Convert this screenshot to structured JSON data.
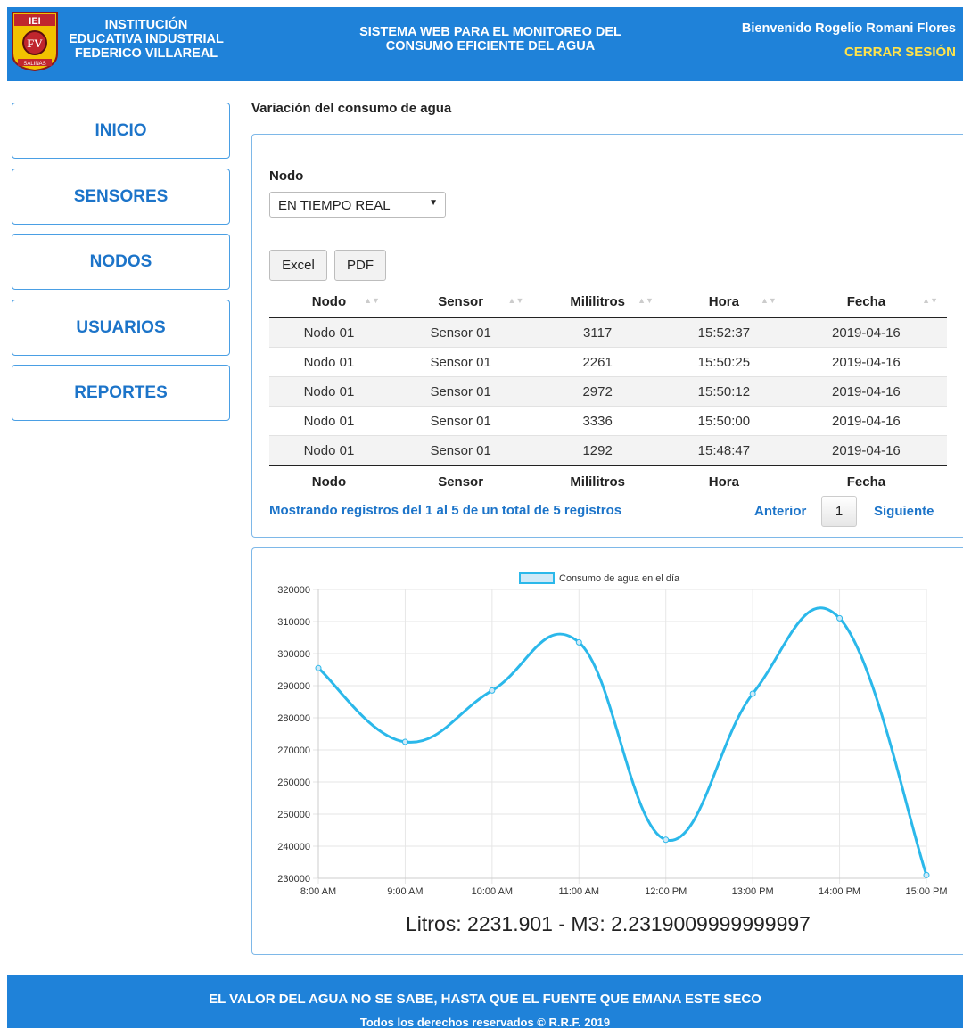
{
  "header": {
    "logo_text": "IEI",
    "logo_badge": "FV",
    "logo_caption": "SALINAS",
    "school_lines": [
      "INSTITUCIÓN",
      "EDUCATIVA INDUSTRIAL",
      "FEDERICO VILLAREAL"
    ],
    "system_lines": [
      "SISTEMA WEB PARA EL MONITOREO DEL",
      "CONSUMO EFICIENTE DEL AGUA"
    ],
    "welcome": "Bienvenido Rogelio Romani Flores",
    "logout": "CERRAR SESIÓN"
  },
  "sidebar": {
    "items": [
      {
        "label": "INICIO"
      },
      {
        "label": "SENSORES"
      },
      {
        "label": "NODOS"
      },
      {
        "label": "USUARIOS"
      },
      {
        "label": "REPORTES"
      }
    ]
  },
  "main": {
    "title": "Variación del consumo de agua",
    "nodo_label": "Nodo",
    "nodo_selected": "EN TIEMPO REAL",
    "buttons": {
      "excel": "Excel",
      "pdf": "PDF"
    },
    "table": {
      "columns": [
        "Nodo",
        "Sensor",
        "Mililitros",
        "Hora",
        "Fecha"
      ],
      "rows": [
        [
          "Nodo 01",
          "Sensor 01",
          "3117",
          "15:52:37",
          "2019-04-16"
        ],
        [
          "Nodo 01",
          "Sensor 01",
          "2261",
          "15:50:25",
          "2019-04-16"
        ],
        [
          "Nodo 01",
          "Sensor 01",
          "2972",
          "15:50:12",
          "2019-04-16"
        ],
        [
          "Nodo 01",
          "Sensor 01",
          "3336",
          "15:50:00",
          "2019-04-16"
        ],
        [
          "Nodo 01",
          "Sensor 01",
          "1292",
          "15:48:47",
          "2019-04-16"
        ]
      ]
    },
    "info": "Mostrando registros del 1 al 5 de un total de 5 registros",
    "pagination": {
      "prev": "Anterior",
      "page": "1",
      "next": "Siguiente"
    },
    "summary": "Litros: 2231.901 - M3: 2.2319009999999997"
  },
  "chart_data": {
    "type": "line",
    "categories": [
      "8:00 AM",
      "9:00 AM",
      "10:00 AM",
      "11:00 AM",
      "12:00 PM",
      "13:00 PM",
      "14:00 PM",
      "15:00 PM"
    ],
    "series": [
      {
        "name": "Consumo de agua en el día",
        "values": [
          295500,
          272500,
          288500,
          303500,
          242000,
          287500,
          311000,
          231000
        ],
        "color": "#2bb8ea"
      }
    ],
    "ylim": [
      230000,
      320000
    ],
    "yticks": [
      230000,
      240000,
      250000,
      260000,
      270000,
      280000,
      290000,
      300000,
      310000,
      320000
    ],
    "grid": true,
    "legend": "top"
  },
  "footer": {
    "line1": "EL VALOR DEL AGUA NO SE SABE, HASTA QUE EL FUENTE QUE EMANA ESTE SECO",
    "line2": "Todos los derechos reservados © R.R.F. 2019"
  },
  "colors": {
    "brand": "#1f82d9",
    "accent": "#ffe34a",
    "link": "#1c74c9",
    "line": "#2bb8ea"
  }
}
